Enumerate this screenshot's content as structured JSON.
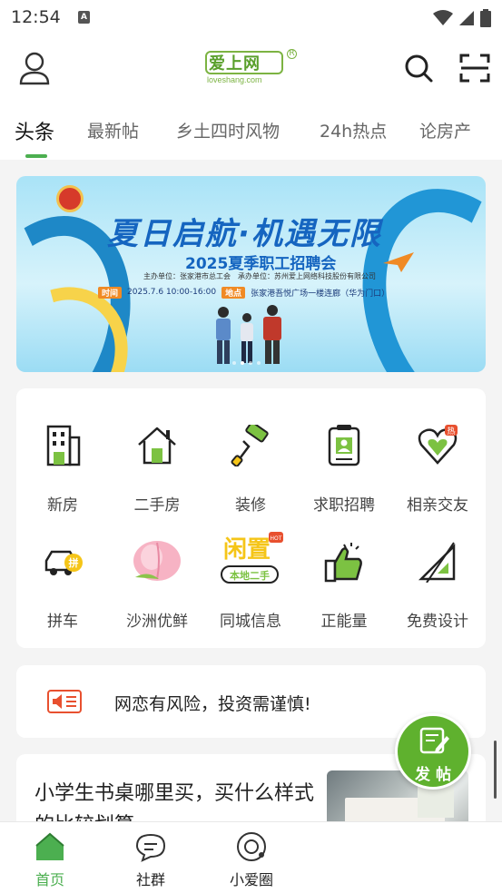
{
  "status_bar": {
    "time": "12:54",
    "notif_glyph": "A"
  },
  "header": {
    "logo_text": "爱上网",
    "logo_sub": "loveshang.com",
    "logo_mark": "R",
    "icons": [
      "user-icon",
      "search-icon",
      "scan-icon"
    ]
  },
  "tabs": [
    "头条",
    "最新帖",
    "乡土四时风物",
    "24h热点",
    "论房产"
  ],
  "active_tab": 0,
  "banner": {
    "title": "夏日启航·机遇无限",
    "subtitle": "2025夏季职工招聘会",
    "organizers": "主办单位：张家港市总工会　承办单位：苏州爱上网络科技股份有限公司",
    "time_label": "时间",
    "time_value": "2025.7.6 10:00-16:00",
    "place_label": "地点",
    "place_value": "张家港吾悦广场一楼连廊（华为门口）",
    "slide_count": 4,
    "active_slide": 1
  },
  "grid": [
    {
      "label": "新房",
      "icon": "building-icon"
    },
    {
      "label": "二手房",
      "icon": "house-icon"
    },
    {
      "label": "装修",
      "icon": "paint-roller-icon"
    },
    {
      "label": "求职招聘",
      "icon": "badge-icon"
    },
    {
      "label": "相亲交友",
      "icon": "heart-icon"
    },
    {
      "label": "拼车",
      "icon": "car-icon"
    },
    {
      "label": "沙洲优鲜",
      "icon": "peach-icon"
    },
    {
      "label": "同城信息",
      "icon": "idle-icon"
    },
    {
      "label": "正能量",
      "icon": "thumbs-up-icon"
    },
    {
      "label": "免费设计",
      "icon": "ruler-icon"
    }
  ],
  "grid_badges": {
    "heart": "热",
    "car": "拼",
    "idle_word": "闲置",
    "idle_tag": "本地二手",
    "idle_hot": "HOT"
  },
  "notice": {
    "text": "网恋有风险，投资需谨慎!",
    "icon": "megaphone-icon"
  },
  "article": {
    "title": "小学生书桌哪里买，买什么样式的比较划算"
  },
  "fab": {
    "label": "发 帖",
    "icon": "edit-icon"
  },
  "bottom_nav": [
    {
      "label": "首页",
      "icon": "home-icon"
    },
    {
      "label": "社群",
      "icon": "chat-icon"
    },
    {
      "label": "小爱圈",
      "icon": "circle-icon"
    }
  ],
  "colors": {
    "accent": "#4caf50",
    "fab": "#5fb12e",
    "banner_blue": "#1565c0"
  }
}
